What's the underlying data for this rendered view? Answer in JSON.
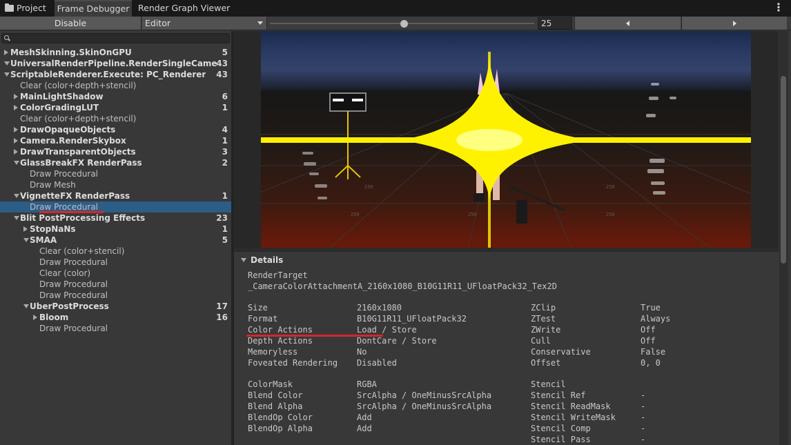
{
  "tabs": [
    {
      "label": "Project",
      "icon": "folder-icon"
    },
    {
      "label": "Frame Debugger",
      "active": true
    },
    {
      "label": "Render Graph Viewer"
    }
  ],
  "toolbar": {
    "disable_label": "Disable",
    "target_select": "Editor",
    "event_index": "25"
  },
  "tree": [
    {
      "label": "MeshSkinning.SkinOnGPU",
      "count": "5",
      "bold": true,
      "indent": 0,
      "fold": "closed"
    },
    {
      "label": "UniversalRenderPipeline.RenderSingleCameraInter",
      "count": "43",
      "bold": true,
      "indent": 0,
      "fold": "open"
    },
    {
      "label": "ScriptableRenderer.Execute: PC_Renderer",
      "count": "43",
      "bold": true,
      "indent": 1,
      "fold": "open"
    },
    {
      "label": "Clear (color+depth+stencil)",
      "count": "",
      "bold": false,
      "indent": 2,
      "fold": ""
    },
    {
      "label": "MainLightShadow",
      "count": "6",
      "bold": true,
      "indent": 2,
      "fold": "closed"
    },
    {
      "label": "ColorGradingLUT",
      "count": "1",
      "bold": true,
      "indent": 2,
      "fold": "closed"
    },
    {
      "label": "Clear (color+depth+stencil)",
      "count": "",
      "bold": false,
      "indent": 2,
      "fold": ""
    },
    {
      "label": "DrawOpaqueObjects",
      "count": "4",
      "bold": true,
      "indent": 2,
      "fold": "closed"
    },
    {
      "label": "Camera.RenderSkybox",
      "count": "1",
      "bold": true,
      "indent": 2,
      "fold": "closed"
    },
    {
      "label": "DrawTransparentObjects",
      "count": "3",
      "bold": true,
      "indent": 2,
      "fold": "closed"
    },
    {
      "label": "GlassBreakFX RenderPass",
      "count": "2",
      "bold": true,
      "indent": 2,
      "fold": "open"
    },
    {
      "label": "Draw Procedural",
      "count": "",
      "bold": false,
      "indent": 3,
      "fold": ""
    },
    {
      "label": "Draw Mesh",
      "count": "",
      "bold": false,
      "indent": 3,
      "fold": ""
    },
    {
      "label": "VignetteFX RenderPass",
      "count": "1",
      "bold": true,
      "indent": 2,
      "fold": "open"
    },
    {
      "label": "Draw Procedural",
      "count": "",
      "bold": false,
      "indent": 3,
      "fold": "",
      "selected": true
    },
    {
      "label": "Blit PostProcessing Effects",
      "count": "23",
      "bold": true,
      "indent": 2,
      "fold": "open"
    },
    {
      "label": "StopNaNs",
      "count": "1",
      "bold": true,
      "indent": 3,
      "fold": "closed"
    },
    {
      "label": "SMAA",
      "count": "5",
      "bold": true,
      "indent": 3,
      "fold": "open"
    },
    {
      "label": "Clear (color+stencil)",
      "count": "",
      "bold": false,
      "indent": 4,
      "fold": ""
    },
    {
      "label": "Draw Procedural",
      "count": "",
      "bold": false,
      "indent": 4,
      "fold": ""
    },
    {
      "label": "Clear (color)",
      "count": "",
      "bold": false,
      "indent": 4,
      "fold": ""
    },
    {
      "label": "Draw Procedural",
      "count": "",
      "bold": false,
      "indent": 4,
      "fold": ""
    },
    {
      "label": "Draw Procedural",
      "count": "",
      "bold": false,
      "indent": 4,
      "fold": ""
    },
    {
      "label": "UberPostProcess",
      "count": "17",
      "bold": true,
      "indent": 3,
      "fold": "open"
    },
    {
      "label": "Bloom",
      "count": "16",
      "bold": true,
      "indent": 4,
      "fold": "closed"
    },
    {
      "label": "Draw Procedural",
      "count": "",
      "bold": false,
      "indent": 4,
      "fold": ""
    }
  ],
  "details": {
    "header": "Details",
    "render_target_label": "RenderTarget",
    "render_target_value": "_CameraColorAttachmentA_2160x1080_B10G11R11_UFloatPack32_Tex2D",
    "left_group_1": [
      {
        "k": "Size",
        "v": "2160x1080"
      },
      {
        "k": "Format",
        "v": "B10G11R11_UFloatPack32"
      },
      {
        "k": "Color Actions",
        "v": "Load / Store"
      },
      {
        "k": "Depth Actions",
        "v": "DontCare / Store"
      },
      {
        "k": "Memoryless",
        "v": "No"
      },
      {
        "k": "Foveated Rendering",
        "v": "Disabled"
      }
    ],
    "right_group_1": [
      {
        "k": "ZClip",
        "v": "True"
      },
      {
        "k": "ZTest",
        "v": "Always"
      },
      {
        "k": "ZWrite",
        "v": "Off"
      },
      {
        "k": "Cull",
        "v": "Off"
      },
      {
        "k": "Conservative",
        "v": "False"
      },
      {
        "k": "Offset",
        "v": "0, 0"
      }
    ],
    "left_group_2": [
      {
        "k": "ColorMask",
        "v": "RGBA"
      },
      {
        "k": "Blend Color",
        "v": "SrcAlpha / OneMinusSrcAlpha"
      },
      {
        "k": "Blend Alpha",
        "v": "SrcAlpha / OneMinusSrcAlpha"
      },
      {
        "k": "BlendOp Color",
        "v": "Add"
      },
      {
        "k": "BlendOp Alpha",
        "v": "Add"
      }
    ],
    "right_group_2": [
      {
        "k": "Stencil",
        "v": ""
      },
      {
        "k": "Stencil Ref",
        "v": "-"
      },
      {
        "k": "Stencil ReadMask",
        "v": "-"
      },
      {
        "k": "Stencil WriteMask",
        "v": "-"
      },
      {
        "k": "Stencil Comp",
        "v": "-"
      },
      {
        "k": "Stencil Pass",
        "v": "-"
      }
    ]
  },
  "scene_labels": [
    "250",
    "250",
    "250",
    "250",
    "250"
  ],
  "colors": {
    "selection": "#2c5d87",
    "highlight_underline": "#d8262a",
    "flare": "#fff000"
  }
}
